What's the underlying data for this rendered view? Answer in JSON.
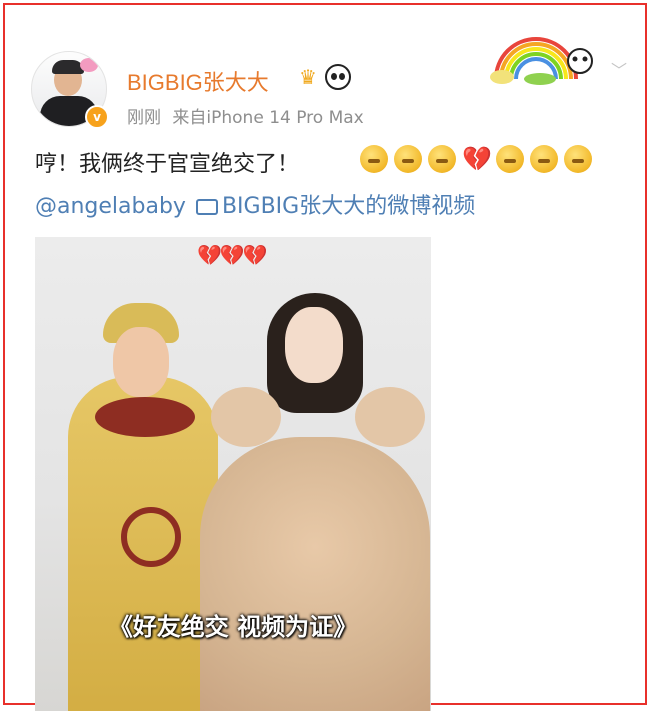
{
  "post": {
    "username": "BIGBIG张大大",
    "verified_badge": "v",
    "time": "刚刚",
    "source": "来自iPhone 14 Pro Max",
    "text": "哼！我俩终于官宣绝交了！",
    "emojis": [
      "face-emoji",
      "face-emoji",
      "face-emoji",
      "broken-heart-emoji",
      "face-emoji",
      "face-emoji",
      "face-emoji"
    ],
    "mention": "@angelababy",
    "video_link": "BIGBIG张大大的微博视频",
    "video_caption": "《好友绝交 视频为证》",
    "overlay_hearts": "💔💔💔"
  },
  "icons": {
    "crown": "crown-icon",
    "panda": "panda-icon",
    "chevron": "chevron-down-icon"
  },
  "colors": {
    "border": "#e8302b",
    "username": "#e77a2d",
    "link": "#4f7fb4",
    "meta": "#8e8e8e"
  }
}
